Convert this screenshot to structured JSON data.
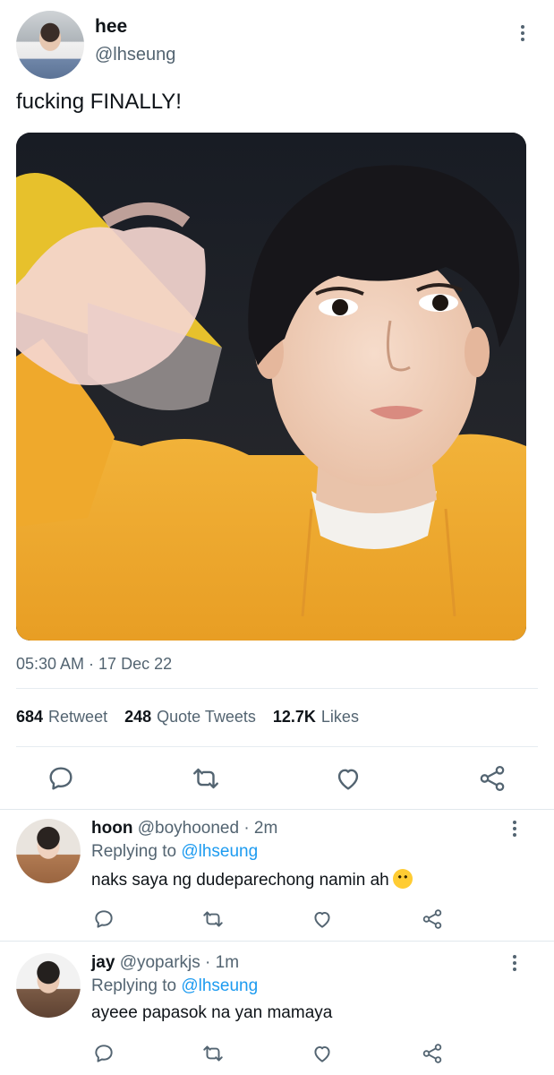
{
  "tweet": {
    "author_name": "hee",
    "author_handle": "@lhseung",
    "text": "fucking FINALLY!",
    "timestamp": "05:30 AM · 17 Dec 22",
    "stats": {
      "retweets_count": "684",
      "retweets_label": "Retweet",
      "quotes_count": "248",
      "quotes_label": "Quote Tweets",
      "likes_count": "12.7K",
      "likes_label": "Likes"
    },
    "actions": [
      "reply-icon",
      "retweet-icon",
      "like-icon",
      "share-icon"
    ]
  },
  "replies": [
    {
      "name": "hoon",
      "handle": "@boyhooned",
      "time": "· 2m",
      "replying_prefix": "Replying to",
      "replying_to": "@lhseung",
      "text": "naks saya ng dudeparechong namin ah",
      "emoji": "hugging-face-emoji"
    },
    {
      "name": "jay",
      "handle": "@yoparkjs",
      "time": "· 1m",
      "replying_prefix": "Replying to",
      "replying_to": "@lhseung",
      "text": "ayeee papasok na yan mamaya"
    }
  ],
  "colors": {
    "text_primary": "#0f1419",
    "text_secondary": "#536471",
    "link": "#1d9bf0",
    "divider": "#e6ecf0"
  }
}
